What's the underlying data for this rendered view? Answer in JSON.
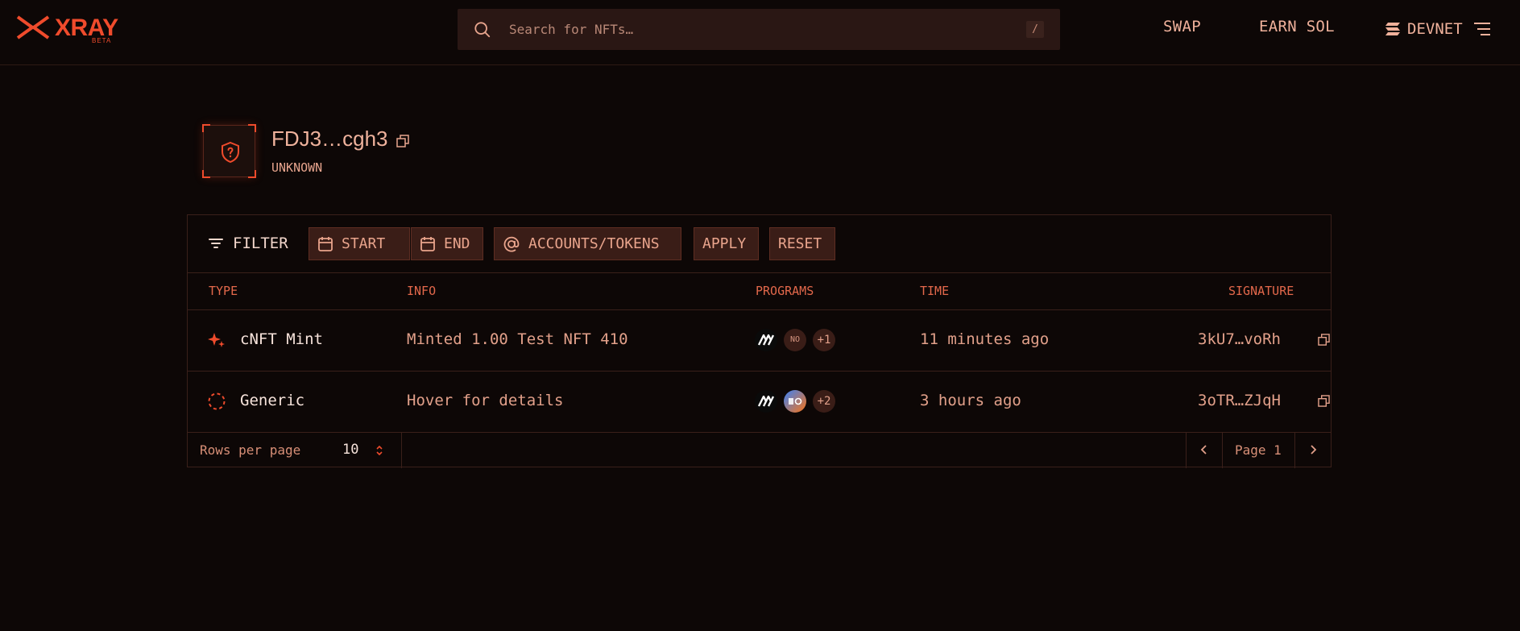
{
  "header": {
    "logo_text": "XRAY",
    "logo_badge": "BETA",
    "search_placeholder": "Search for NFTs…",
    "search_shortcut": "/",
    "nav_swap": "SWAP",
    "nav_earn": "EARN SOL",
    "network": "DEVNET"
  },
  "profile": {
    "address": "FDJ3…cgh3",
    "type": "UNKNOWN"
  },
  "filters": {
    "title": "FILTER",
    "start": "START",
    "end": "END",
    "accounts": "ACCOUNTS/TOKENS",
    "apply": "APPLY",
    "reset": "RESET"
  },
  "table": {
    "columns": [
      "TYPE",
      "INFO",
      "PROGRAMS",
      "TIME",
      "SIGNATURE"
    ],
    "rows": [
      {
        "type": "cNFT Mint",
        "info": "Minted 1.00 Test NFT 410",
        "program_badge": "NO",
        "program_more": "+1",
        "time": "11 minutes ago",
        "signature": "3kU7…voRh"
      },
      {
        "type": "Generic",
        "info": "Hover for details",
        "program_more": "+2",
        "time": "3 hours ago",
        "signature": "3oTR…ZJqH"
      }
    ]
  },
  "pagination": {
    "rows_label": "Rows per page",
    "rows_value": "10",
    "page_label": "Page 1"
  },
  "colors": {
    "accent": "#ef4b2c",
    "background": "#0d0706"
  }
}
